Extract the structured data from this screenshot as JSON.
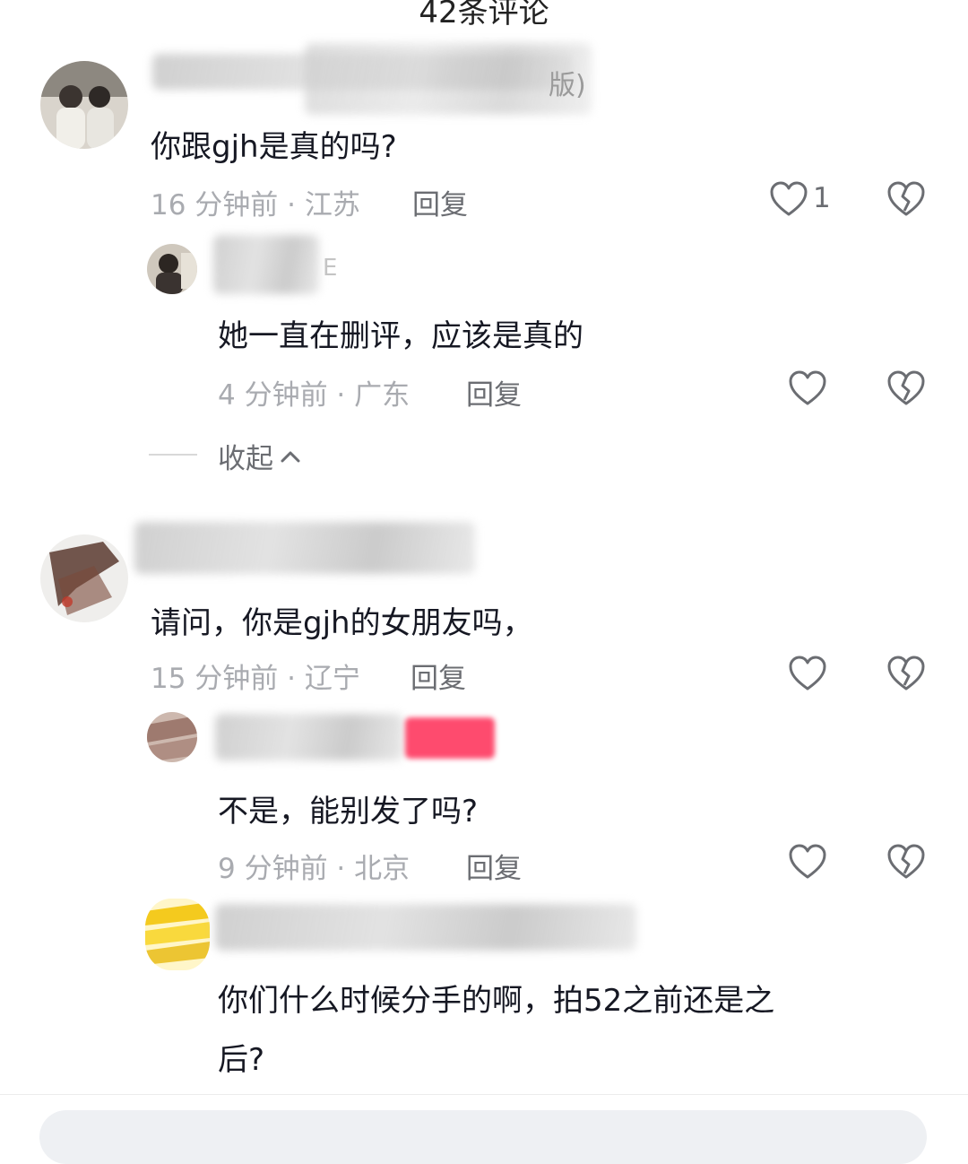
{
  "header": {
    "title": "42条评论"
  },
  "comments": [
    {
      "username_visible": "版)",
      "text": "你跟gjh是真的吗?",
      "time_location": "16 分钟前 · 江苏",
      "reply_label": "回复",
      "like_count": "1",
      "replies": [
        {
          "username_visible": "E",
          "text": "她一直在删评，应该是真的",
          "time_location": "4 分钟前 · 广东",
          "reply_label": "回复"
        }
      ],
      "collapse_label": "收起"
    },
    {
      "username_visible": "",
      "text": "请问，你是gjh的女朋友吗，",
      "time_location": "15 分钟前 · 辽宁",
      "reply_label": "回复",
      "replies": [
        {
          "username_visible": "",
          "text": "不是，能别发了吗?",
          "time_location": "9 分钟前 · 北京",
          "reply_label": "回复"
        },
        {
          "username_visible": "",
          "text_line1": "你们什么时候分手的啊，拍52之前还是之",
          "text_line2": "后?"
        }
      ]
    }
  ],
  "colors": {
    "text_primary": "#161823",
    "text_meta": "#a9abb0",
    "text_action": "#6b6d72",
    "author_badge": "#fe2c55"
  },
  "icons": [
    "heart-outline-icon",
    "broken-heart-icon",
    "chevron-up-icon"
  ]
}
